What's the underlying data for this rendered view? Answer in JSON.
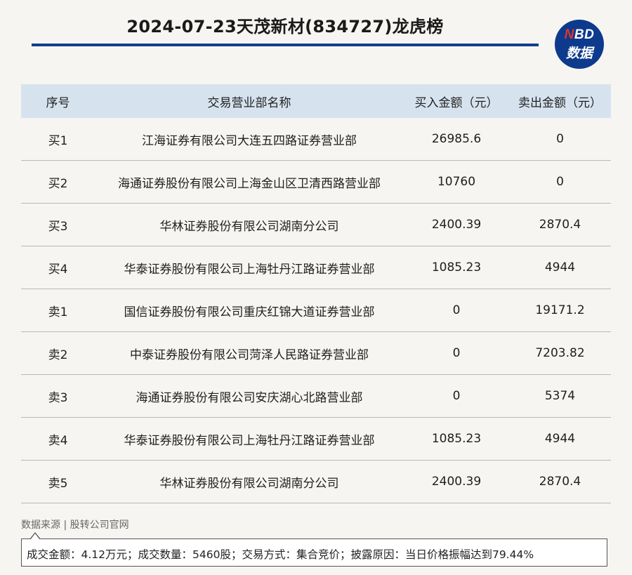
{
  "header": {
    "title": "2024-07-23天茂新材(834727)龙虎榜"
  },
  "logo": {
    "line1_n": "N",
    "line1_rest": "BD",
    "line2": "数据",
    "bg_color": "#0d3a8c",
    "accent_color": "#e2322f"
  },
  "table": {
    "columns": [
      "序号",
      "交易营业部名称",
      "买入金额（元）",
      "卖出金额（元）"
    ],
    "rows": [
      {
        "seq": "买1",
        "name": "江海证券有限公司大连五四路证券营业部",
        "buy": "26985.6",
        "sell": "0"
      },
      {
        "seq": "买2",
        "name": "海通证券股份有限公司上海金山区卫清西路营业部",
        "buy": "10760",
        "sell": "0"
      },
      {
        "seq": "买3",
        "name": "华林证券股份有限公司湖南分公司",
        "buy": "2400.39",
        "sell": "2870.4"
      },
      {
        "seq": "买4",
        "name": "华泰证券股份有限公司上海牡丹江路证券营业部",
        "buy": "1085.23",
        "sell": "4944"
      },
      {
        "seq": "卖1",
        "name": "国信证券股份有限公司重庆红锦大道证券营业部",
        "buy": "0",
        "sell": "19171.2"
      },
      {
        "seq": "卖2",
        "name": "中泰证券股份有限公司菏泽人民路证券营业部",
        "buy": "0",
        "sell": "7203.82"
      },
      {
        "seq": "卖3",
        "name": "海通证券股份有限公司安庆湖心北路营业部",
        "buy": "0",
        "sell": "5374"
      },
      {
        "seq": "卖4",
        "name": "华泰证券股份有限公司上海牡丹江路证券营业部",
        "buy": "1085.23",
        "sell": "4944"
      },
      {
        "seq": "卖5",
        "name": "华林证券股份有限公司湖南分公司",
        "buy": "2400.39",
        "sell": "2870.4"
      }
    ]
  },
  "footer": {
    "source": "数据来源 | 股转公司官网",
    "note": "成交金额：4.12万元；成交数量：5460股；交易方式：集合竞价；披露原因：当日价格振幅达到79.44%"
  }
}
